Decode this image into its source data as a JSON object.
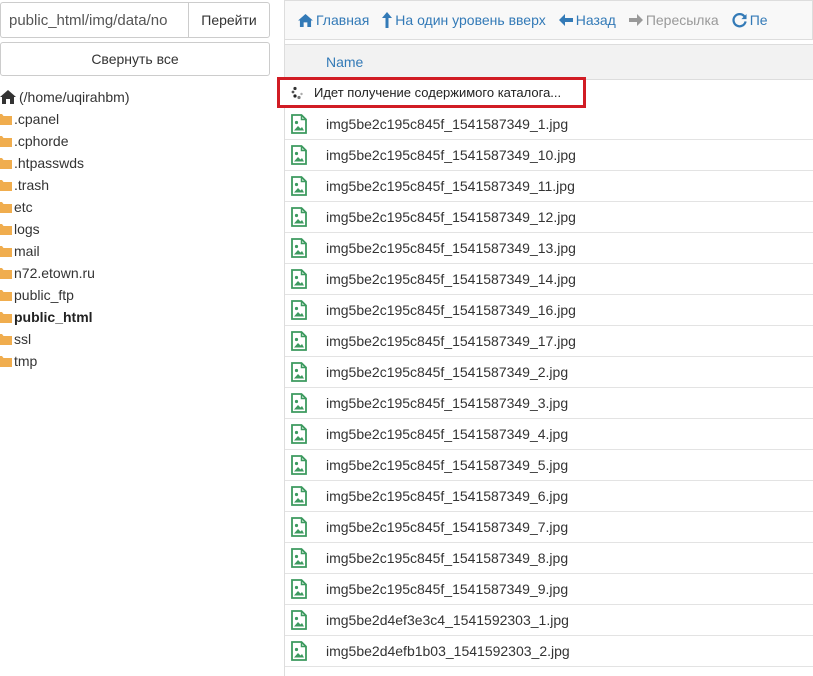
{
  "left": {
    "path_value": "public_html/img/data/no",
    "go_label": "Перейти",
    "collapse_label": "Свернуть все",
    "root_label": "(/home/uqirahbm)",
    "folders": [
      {
        "label": ".cpanel",
        "bold": false
      },
      {
        "label": ".cphorde",
        "bold": false
      },
      {
        "label": ".htpasswds",
        "bold": false
      },
      {
        "label": ".trash",
        "bold": false
      },
      {
        "label": "etc",
        "bold": false
      },
      {
        "label": "logs",
        "bold": false
      },
      {
        "label": "mail",
        "bold": false
      },
      {
        "label": "n72.etown.ru",
        "bold": false
      },
      {
        "label": "public_ftp",
        "bold": false
      },
      {
        "label": "public_html",
        "bold": true
      },
      {
        "label": "ssl",
        "bold": false
      },
      {
        "label": "tmp",
        "bold": false
      }
    ]
  },
  "toolbar": {
    "home": "Главная",
    "up": "На один уровень вверх",
    "back": "Назад",
    "forward": "Пересылка",
    "reload": "Пе"
  },
  "table": {
    "name_header": "Name",
    "loading_text": "Идет получение содержимого каталога...",
    "files": [
      "img5be2c195c845f_1541587349_1.jpg",
      "img5be2c195c845f_1541587349_10.jpg",
      "img5be2c195c845f_1541587349_11.jpg",
      "img5be2c195c845f_1541587349_12.jpg",
      "img5be2c195c845f_1541587349_13.jpg",
      "img5be2c195c845f_1541587349_14.jpg",
      "img5be2c195c845f_1541587349_16.jpg",
      "img5be2c195c845f_1541587349_17.jpg",
      "img5be2c195c845f_1541587349_2.jpg",
      "img5be2c195c845f_1541587349_3.jpg",
      "img5be2c195c845f_1541587349_4.jpg",
      "img5be2c195c845f_1541587349_5.jpg",
      "img5be2c195c845f_1541587349_6.jpg",
      "img5be2c195c845f_1541587349_7.jpg",
      "img5be2c195c845f_1541587349_8.jpg",
      "img5be2c195c845f_1541587349_9.jpg",
      "img5be2d4ef3e3c4_1541592303_1.jpg",
      "img5be2d4efb1b03_1541592303_2.jpg"
    ]
  },
  "colors": {
    "link": "#337ab7",
    "folder": "#f0ad4e",
    "file_icon": "#3c9a5f",
    "highlight": "#d11c24"
  },
  "icons": {
    "home": "home-icon",
    "up": "level-up-icon",
    "back": "arrow-left-icon",
    "forward": "arrow-right-icon",
    "reload": "refresh-icon",
    "folder": "folder-icon",
    "file": "image-file-icon",
    "spinner": "spinner-icon"
  }
}
